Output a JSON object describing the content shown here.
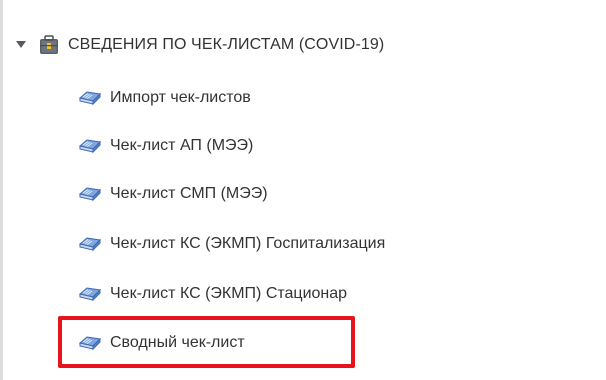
{
  "tree": {
    "root": {
      "label": "СВЕДЕНИЯ ПО ЧЕК-ЛИСТАМ (COVID-19)",
      "expanded": true,
      "icon": "briefcase-folder-icon"
    },
    "children": [
      {
        "label": "Импорт чек-листов",
        "icon": "document-book-icon"
      },
      {
        "label": "Чек-лист АП (МЭЭ)",
        "icon": "document-book-icon"
      },
      {
        "label": "Чек-лист СМП (МЭЭ)",
        "icon": "document-book-icon"
      },
      {
        "label": "Чек-лист КС (ЭКМП) Госпитализация",
        "icon": "document-book-icon"
      },
      {
        "label": "Чек-лист КС (ЭКМП) Стационар",
        "icon": "document-book-icon"
      },
      {
        "label": "Сводный чек-лист",
        "icon": "document-book-icon",
        "highlighted": true
      }
    ]
  },
  "colors": {
    "text": "#333333",
    "highlight_border": "#e8141c",
    "icon_blue": "#4a78c4",
    "folder_dark": "#5a5f66"
  }
}
